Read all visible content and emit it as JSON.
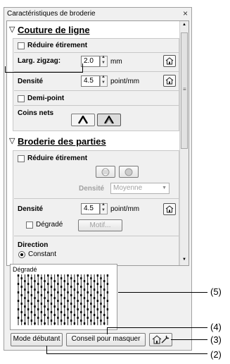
{
  "window": {
    "title": "Caractéristiques de broderie",
    "close_glyph": "×"
  },
  "sec1": {
    "title": "Couture de ligne",
    "reduce_label": "Réduire étirement",
    "zigzag_label": "Larg. zigzag:",
    "zigzag_value": "2.0",
    "zigzag_unit": "mm",
    "density_label": "Densité",
    "density_value": "4.5",
    "density_unit": "point/mm",
    "halfpoint_label": "Demi-point",
    "corners_label": "Coins nets"
  },
  "sec2": {
    "title": "Broderie des parties",
    "reduce_label": "Réduire étirement",
    "density_label_disabled": "Densité",
    "density_select_value": "Moyenne",
    "density_label": "Densité",
    "density_value": "4.5",
    "density_unit": "point/mm",
    "gradient_label": "Dégradé",
    "motif_label": "Motif...",
    "direction_label": "Direction",
    "constant_label": "Constant"
  },
  "preview": {
    "label": "Dégradé"
  },
  "buttons": {
    "beginner_label": "Mode débutant",
    "hide_label": "Conseil pour masquer"
  },
  "callouts": [
    "(5)",
    "(4)",
    "(3)",
    "(2)"
  ]
}
